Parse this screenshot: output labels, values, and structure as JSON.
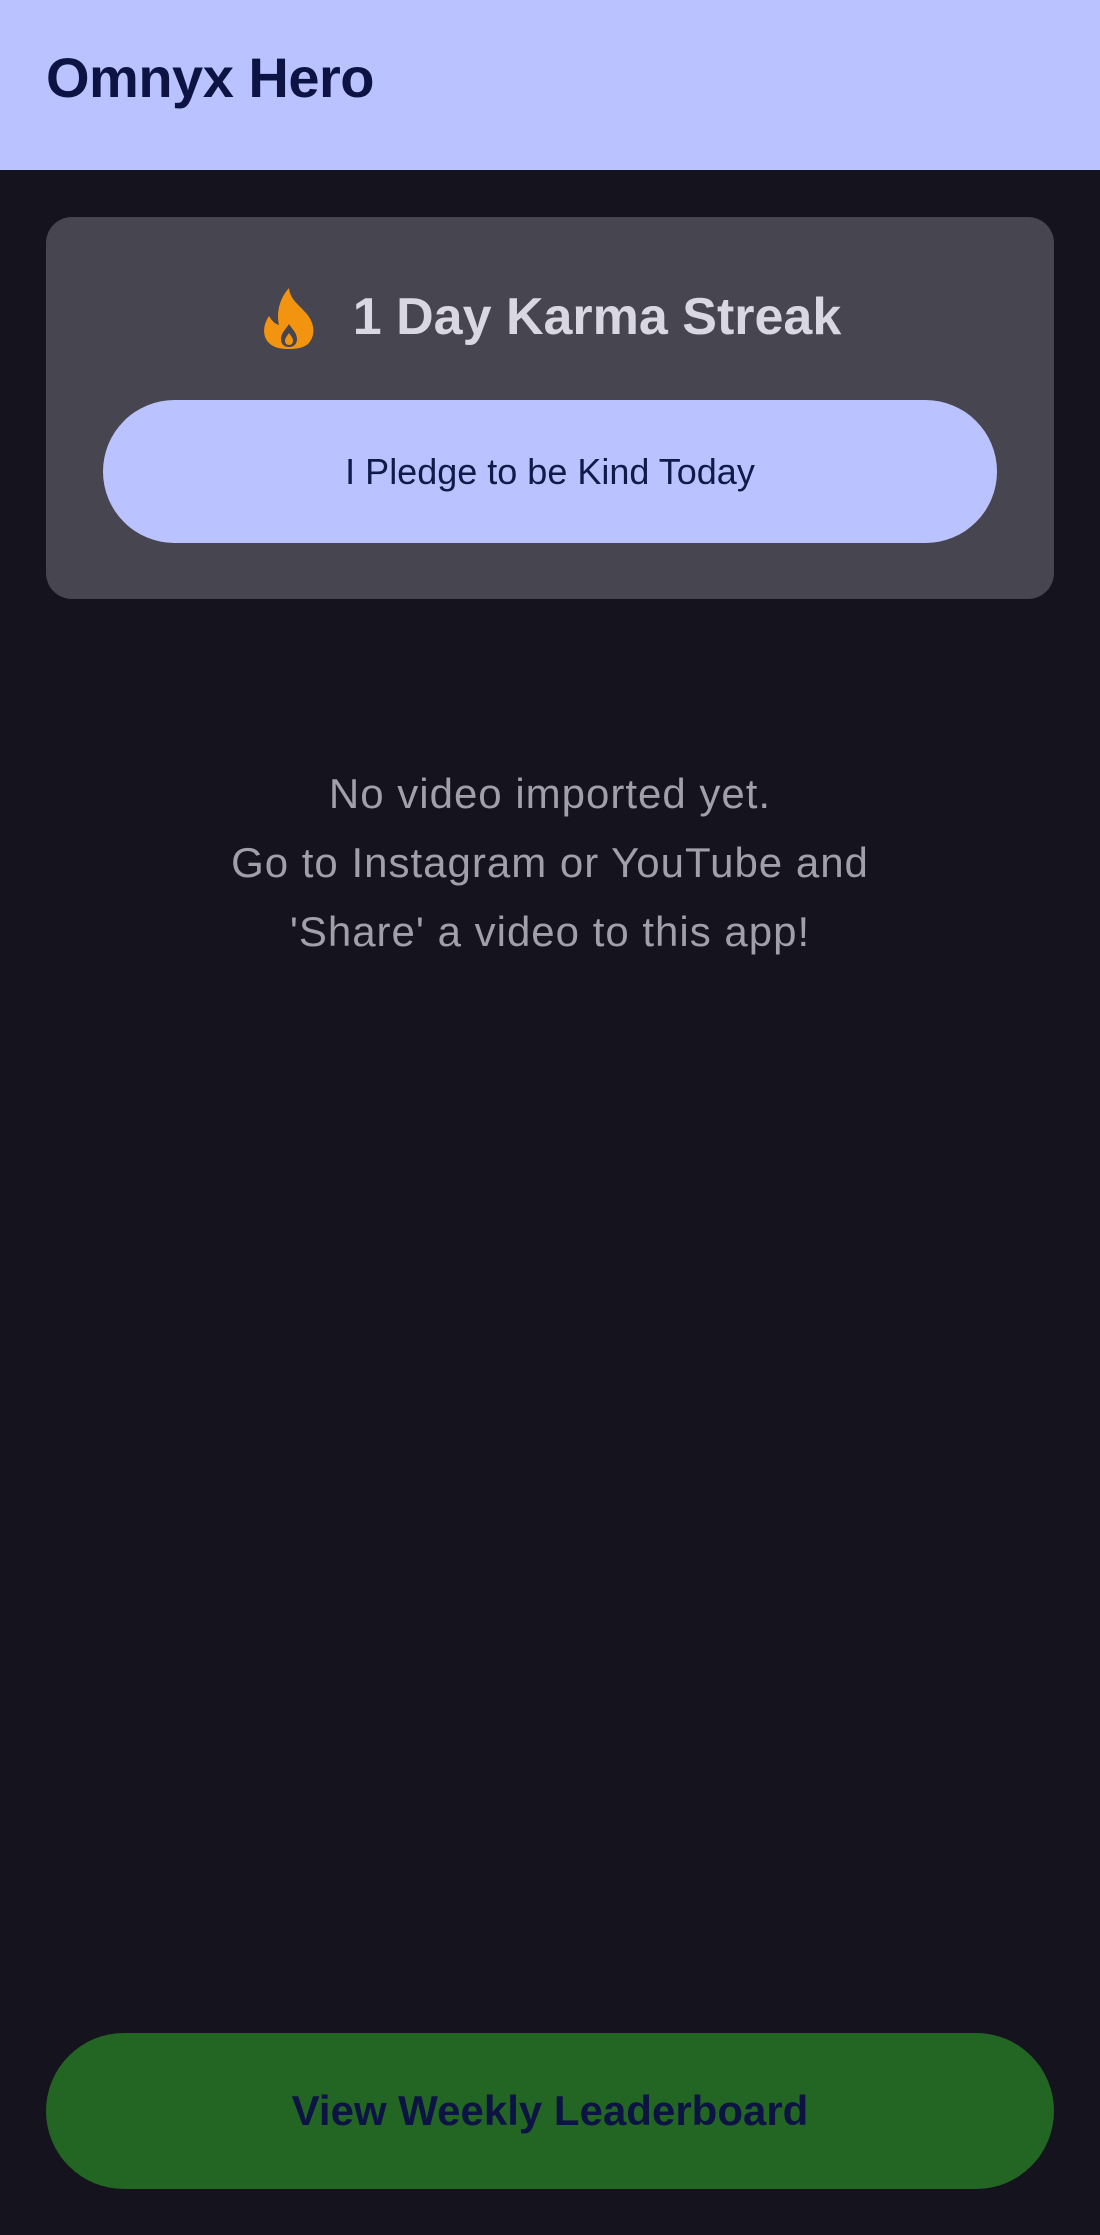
{
  "app_bar": {
    "title": "Omnyx Hero"
  },
  "streak_card": {
    "icon": "fire-icon",
    "streak_text": "1 Day Karma Streak",
    "pledge_button_label": "I Pledge to be Kind Today"
  },
  "empty_state": {
    "lines": [
      "No video imported yet.",
      "Go to Instagram or YouTube and",
      "'Share' a video to this app!"
    ]
  },
  "footer": {
    "leaderboard_button_label": "View Weekly Leaderboard"
  },
  "colors": {
    "app_bar_background": "#bac3ff",
    "screen_background": "#15131d",
    "card_background": "#47454f",
    "fire_icon": "#f2940f",
    "leaderboard_button": "#236624"
  }
}
